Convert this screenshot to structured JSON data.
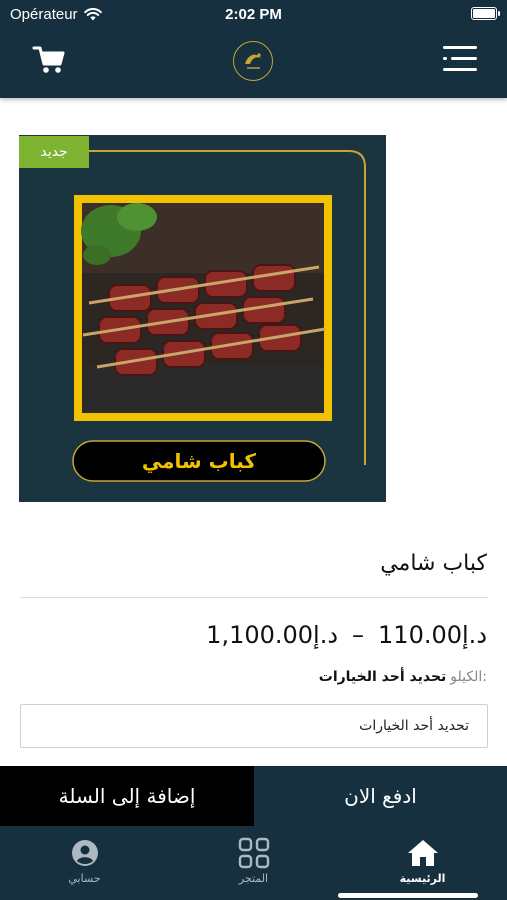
{
  "status_bar": {
    "carrier": "Opérateur",
    "time": "2:02 PM"
  },
  "header": {
    "logo": "store-logo",
    "menu_icon": "menu-icon",
    "cart_icon": "cart-icon"
  },
  "product": {
    "badge": "جديد",
    "image_caption": "كباب شامي",
    "title": "كباب شامي",
    "price_min": "د.إ110.00",
    "price_separator": "–",
    "price_max": "د.إ1,100.00",
    "weight_label": "الكيلو:",
    "weight_value": "تحديد أحد الخيارات",
    "select_placeholder": "تحديد أحد الخيارات"
  },
  "actions": {
    "pay_now": "ادفع الان",
    "add_to_cart": "إضافة إلى السلة"
  },
  "tabbar": {
    "items": [
      {
        "label": "الرئيسية",
        "icon": "home-icon",
        "active": true
      },
      {
        "label": "المتجر",
        "icon": "grid-icon",
        "active": false
      },
      {
        "label": "حسابي",
        "icon": "account-icon",
        "active": false
      }
    ]
  },
  "colors": {
    "primary": "#173040",
    "accent_green": "#7fb432",
    "gold": "#c8a533",
    "frame_yellow": "#f2c200"
  }
}
